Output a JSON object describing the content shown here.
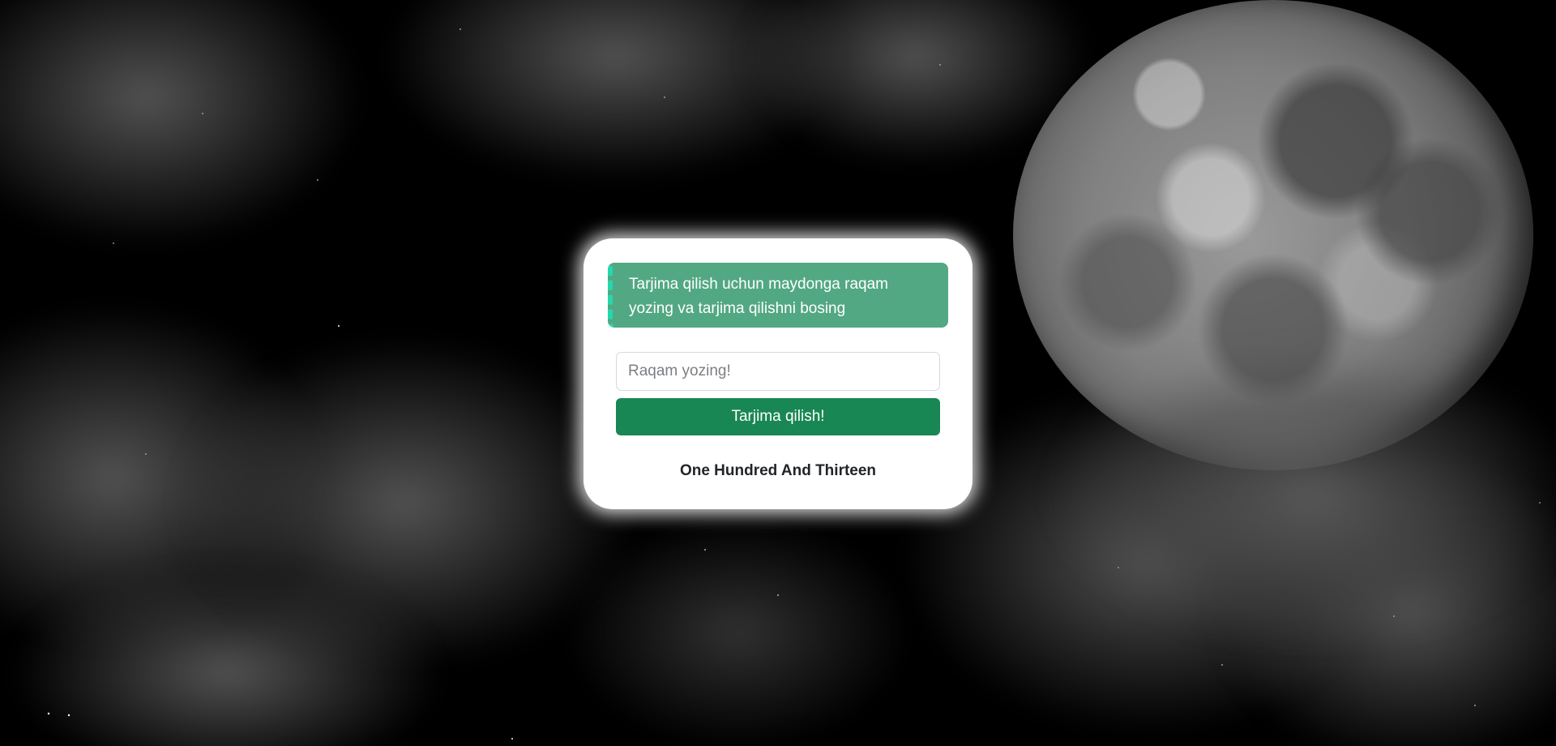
{
  "alert": {
    "line1": "Tarjima qilish uchun maydonga raqam",
    "line2": "yozing va tarjima qilishni bosing"
  },
  "form": {
    "input_placeholder": "Raqam yozing!",
    "input_value": "",
    "button_label": "Tarjima qilish!"
  },
  "result": {
    "text": "One Hundred And Thirteen"
  },
  "colors": {
    "alert_bg": "#52a882",
    "alert_border": "#26d6ad",
    "button_bg": "#198754"
  }
}
